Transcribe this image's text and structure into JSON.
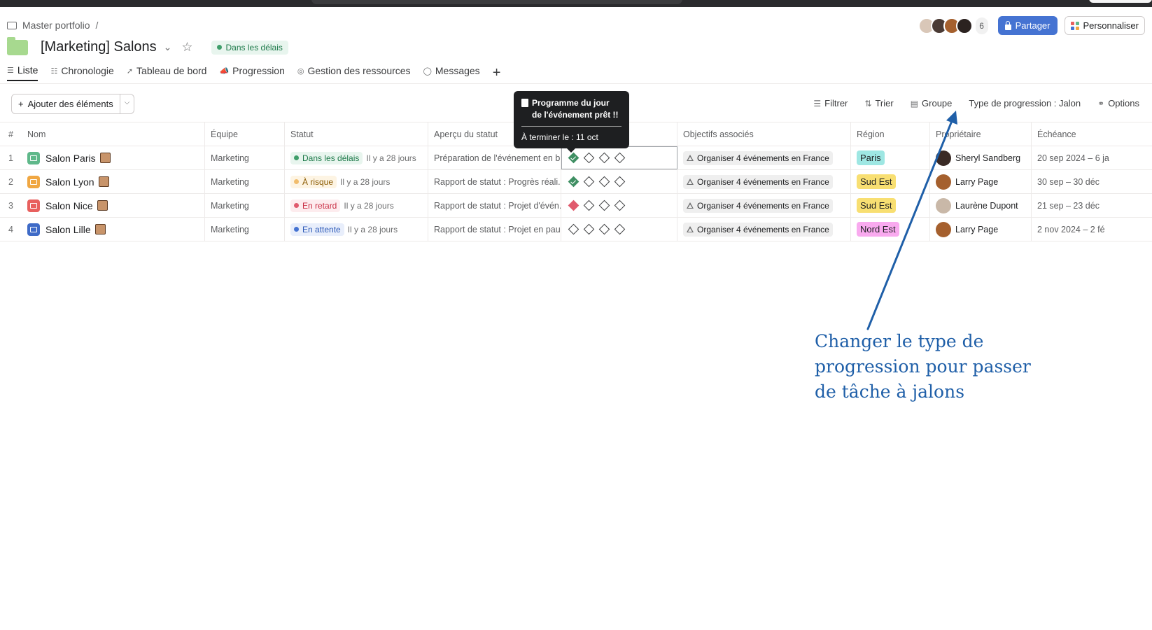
{
  "breadcrumb": {
    "portfolio": "Master portfolio",
    "separator": "/"
  },
  "project": {
    "title": "[Marketing] Salons",
    "status": "Dans les délais",
    "status_color": "#1e7a4a"
  },
  "header": {
    "member_count": "6",
    "share_label": "Partager",
    "customize_label": "Personnaliser",
    "share_color": "#4573d2"
  },
  "tabs": [
    {
      "label": "Liste",
      "icon": "list-icon"
    },
    {
      "label": "Chronologie",
      "icon": "timeline-icon"
    },
    {
      "label": "Tableau de bord",
      "icon": "dashboard-icon"
    },
    {
      "label": "Progression",
      "icon": "progress-icon"
    },
    {
      "label": "Gestion des ressources",
      "icon": "resources-icon"
    },
    {
      "label": "Messages",
      "icon": "chat-icon"
    }
  ],
  "toolbar": {
    "add_label": "Ajouter des éléments",
    "filter": "Filtrer",
    "sort": "Trier",
    "group": "Groupe",
    "progress_type": "Type de progression : Jalon",
    "options": "Options"
  },
  "columns": {
    "num": "#",
    "name": "Nom",
    "team": "Équipe",
    "status": "Statut",
    "overview": "Aperçu du statut",
    "goals": "Objectifs associés",
    "region": "Région",
    "owner": "Propriétaire",
    "due": "Échéance"
  },
  "rows": [
    {
      "num": "1",
      "name": "Salon Paris",
      "icon_color": "#5fb88a",
      "team": "Marketing",
      "status": "Dans les délais",
      "status_bg": "#e8f5ee",
      "status_fg": "#1e7a4a",
      "status_dot": "#3f9e6a",
      "ago": "Il y a 28 jours",
      "overview": "Préparation de l'événement en b...",
      "milestones": [
        "green",
        "empty",
        "empty",
        "empty"
      ],
      "goal": "Organiser 4 événements en France",
      "region": "Paris",
      "region_bg": "#9ee7e3",
      "owner": "Sheryl Sandberg",
      "owner_color": "#3a2a25",
      "due": "20 sep 2024 – 6 ja"
    },
    {
      "num": "2",
      "name": "Salon Lyon",
      "icon_color": "#f0a742",
      "team": "Marketing",
      "status": "À risque",
      "status_bg": "#fdf4e3",
      "status_fg": "#8a5a00",
      "status_dot": "#f1bd6c",
      "ago": "Il y a 28 jours",
      "overview": "Rapport de statut : Progrès réali...",
      "milestones": [
        "green",
        "empty",
        "empty",
        "empty"
      ],
      "goal": "Organiser 4 événements en France",
      "region": "Sud Est",
      "region_bg": "#f8df72",
      "owner": "Larry Page",
      "owner_color": "#a5602e",
      "due": "30 sep – 30 déc"
    },
    {
      "num": "3",
      "name": "Salon Nice",
      "icon_color": "#e8605e",
      "team": "Marketing",
      "status": "En retard",
      "status_bg": "#fdecee",
      "status_fg": "#c92f45",
      "status_dot": "#e05a6d",
      "ago": "Il y a 28 jours",
      "overview": "Rapport de statut : Projet d'évén...",
      "milestones": [
        "red",
        "empty",
        "empty",
        "empty"
      ],
      "goal": "Organiser 4 événements en France",
      "region": "Sud Est",
      "region_bg": "#f8df72",
      "owner": "Laurène Dupont",
      "owner_color": "#c9b8a8",
      "due": "21 sep – 23 déc"
    },
    {
      "num": "4",
      "name": "Salon Lille",
      "icon_color": "#3f6bc7",
      "team": "Marketing",
      "status": "En attente",
      "status_bg": "#e8eefb",
      "status_fg": "#2e5bb8",
      "status_dot": "#4573d2",
      "ago": "Il y a 28 jours",
      "overview": "Rapport de statut : Projet en pau...",
      "milestones": [
        "empty",
        "empty",
        "empty",
        "empty"
      ],
      "goal": "Organiser 4 événements en France",
      "region": "Nord Est",
      "region_bg": "#f9aaef",
      "owner": "Larry Page",
      "owner_color": "#a5602e",
      "due": "2 nov 2024 – 2 fé"
    }
  ],
  "tooltip": {
    "title": "Programme du jour de l'événement prêt !!",
    "due": "À terminer le : 11 oct"
  },
  "annotation": {
    "text": "Changer le type de progression pour passer de tâche à jalons",
    "color": "#1f5fa8"
  }
}
